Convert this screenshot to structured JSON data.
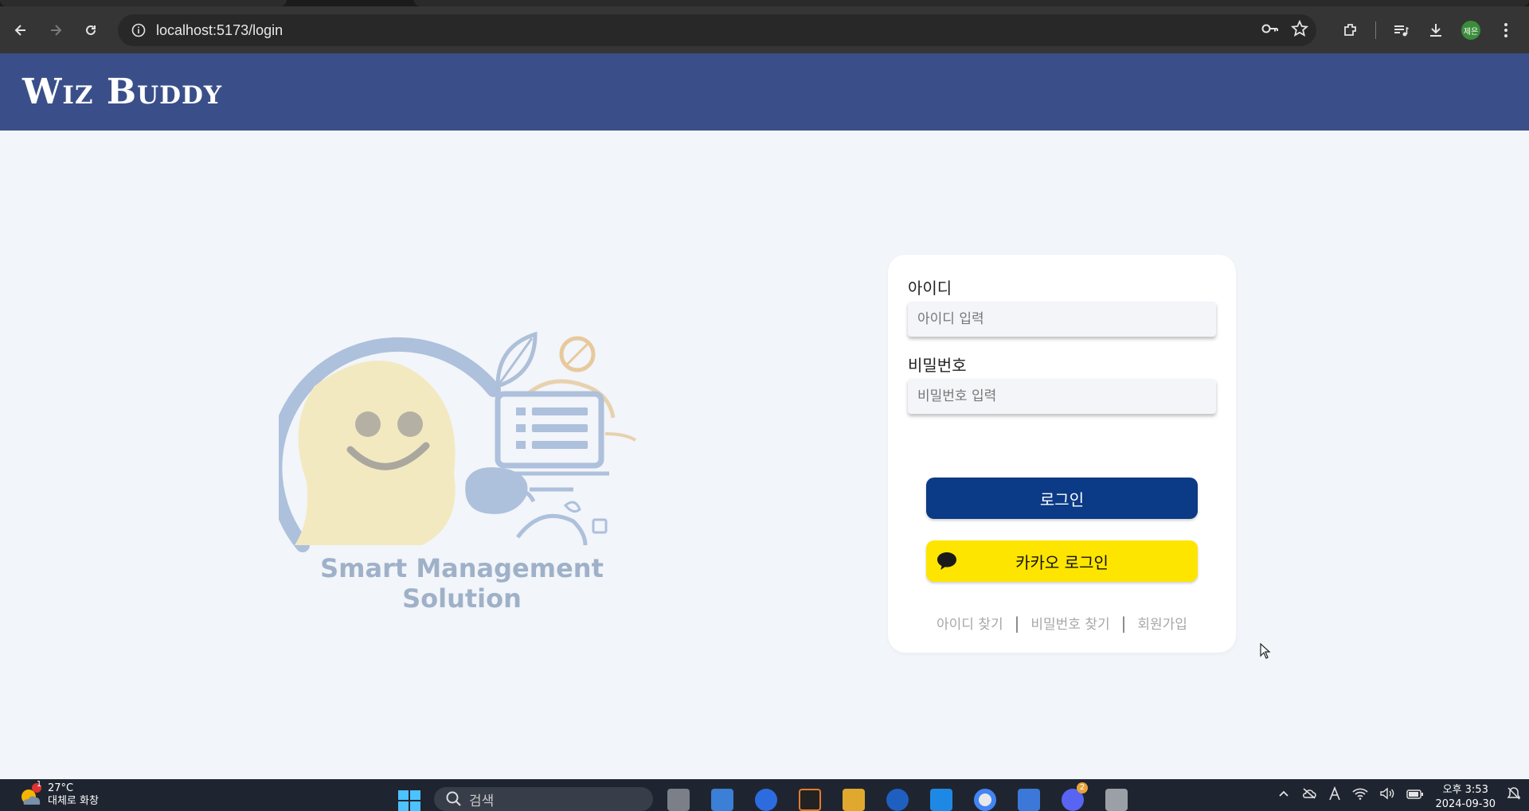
{
  "browser": {
    "url": "localhost:5173/login",
    "profile_initials": "제은"
  },
  "header": {
    "logo_text": "Wiz Buddy"
  },
  "hero": {
    "caption": "Smart Management Solution"
  },
  "login": {
    "id_label": "아이디",
    "id_placeholder": "아이디 입력",
    "pw_label": "비밀번호",
    "pw_placeholder": "비밀번호 입력",
    "login_button": "로그인",
    "kakao_button": "카카오 로그인",
    "links": {
      "find_id": "아이디 찾기",
      "divider": "|",
      "find_pw": "비밀번호 찾기",
      "signup": "회원가입"
    }
  },
  "taskbar": {
    "weather_temp": "27°C",
    "weather_desc": "대체로 화창",
    "weather_badge": "1",
    "search_placeholder": "검색",
    "discord_badge": "2",
    "time": "오후 3:53",
    "date": "2024-09-30"
  },
  "colors": {
    "header_bg": "#3a4f8a",
    "login_button": "#0b3a86",
    "kakao_button": "#fee500",
    "page_bg": "#f2f5f9"
  }
}
